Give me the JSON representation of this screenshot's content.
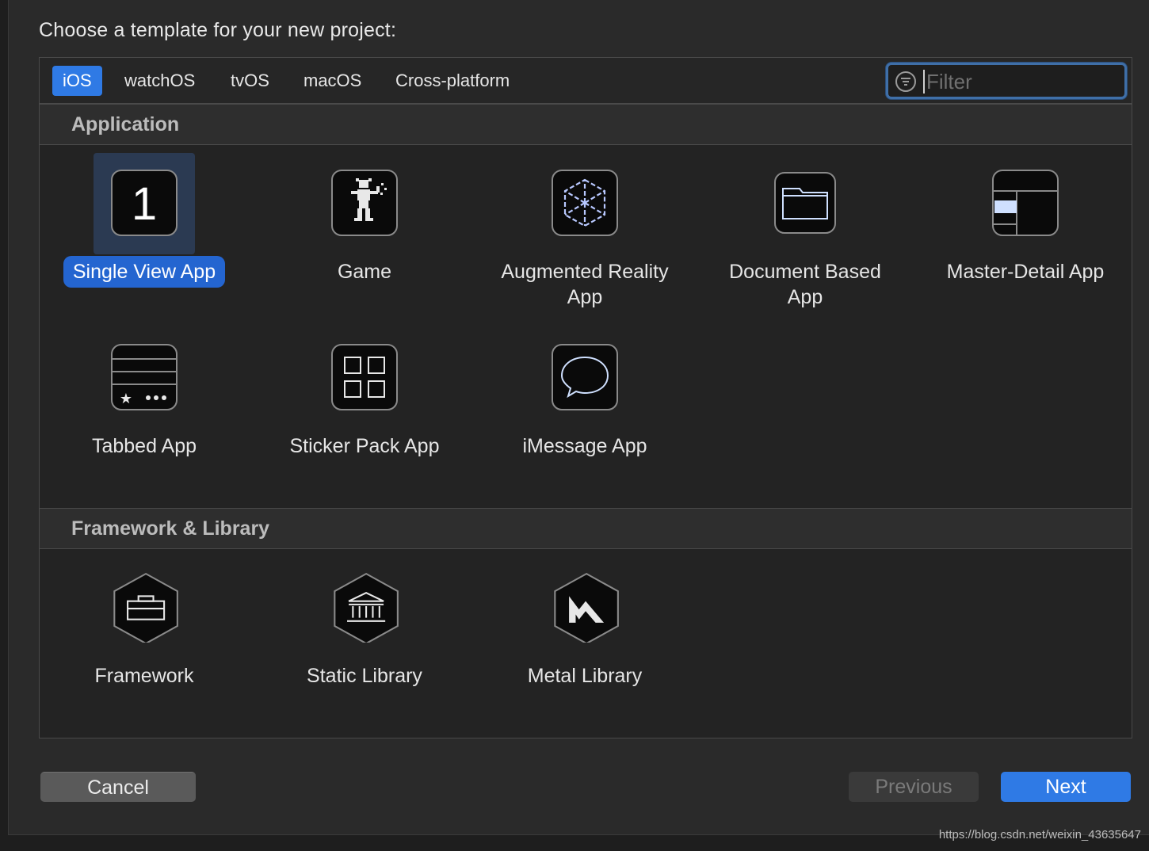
{
  "dialog": {
    "heading": "Choose a template for your new project:"
  },
  "platform_tabs": [
    {
      "label": "iOS",
      "selected": true
    },
    {
      "label": "watchOS",
      "selected": false
    },
    {
      "label": "tvOS",
      "selected": false
    },
    {
      "label": "macOS",
      "selected": false
    },
    {
      "label": "Cross-platform",
      "selected": false
    }
  ],
  "filter": {
    "placeholder": "Filter",
    "value": "",
    "icon": "filter-icon"
  },
  "sections": [
    {
      "title": "Application",
      "templates": [
        {
          "label": "Single View App",
          "icon": "single-view-app-icon",
          "selected": true
        },
        {
          "label": "Game",
          "icon": "game-icon",
          "selected": false
        },
        {
          "label": "Augmented Reality App",
          "icon": "augmented-reality-icon",
          "selected": false
        },
        {
          "label": "Document Based App",
          "icon": "document-based-icon",
          "selected": false
        },
        {
          "label": "Master-Detail App",
          "icon": "master-detail-icon",
          "selected": false
        },
        {
          "label": "Tabbed App",
          "icon": "tabbed-app-icon",
          "selected": false
        },
        {
          "label": "Sticker Pack App",
          "icon": "sticker-pack-icon",
          "selected": false
        },
        {
          "label": "iMessage App",
          "icon": "imessage-icon",
          "selected": false
        }
      ]
    },
    {
      "title": "Framework & Library",
      "templates": [
        {
          "label": "Framework",
          "icon": "framework-icon",
          "selected": false
        },
        {
          "label": "Static Library",
          "icon": "static-library-icon",
          "selected": false
        },
        {
          "label": "Metal Library",
          "icon": "metal-library-icon",
          "selected": false
        }
      ]
    }
  ],
  "buttons": {
    "cancel": "Cancel",
    "previous": "Previous",
    "next": "Next"
  },
  "watermark": "https://blog.csdn.net/weixin_43635647",
  "colors": {
    "accent": "#2f7ae5",
    "selection_bg": "#2b3a52",
    "background": "#2a2a2a"
  }
}
